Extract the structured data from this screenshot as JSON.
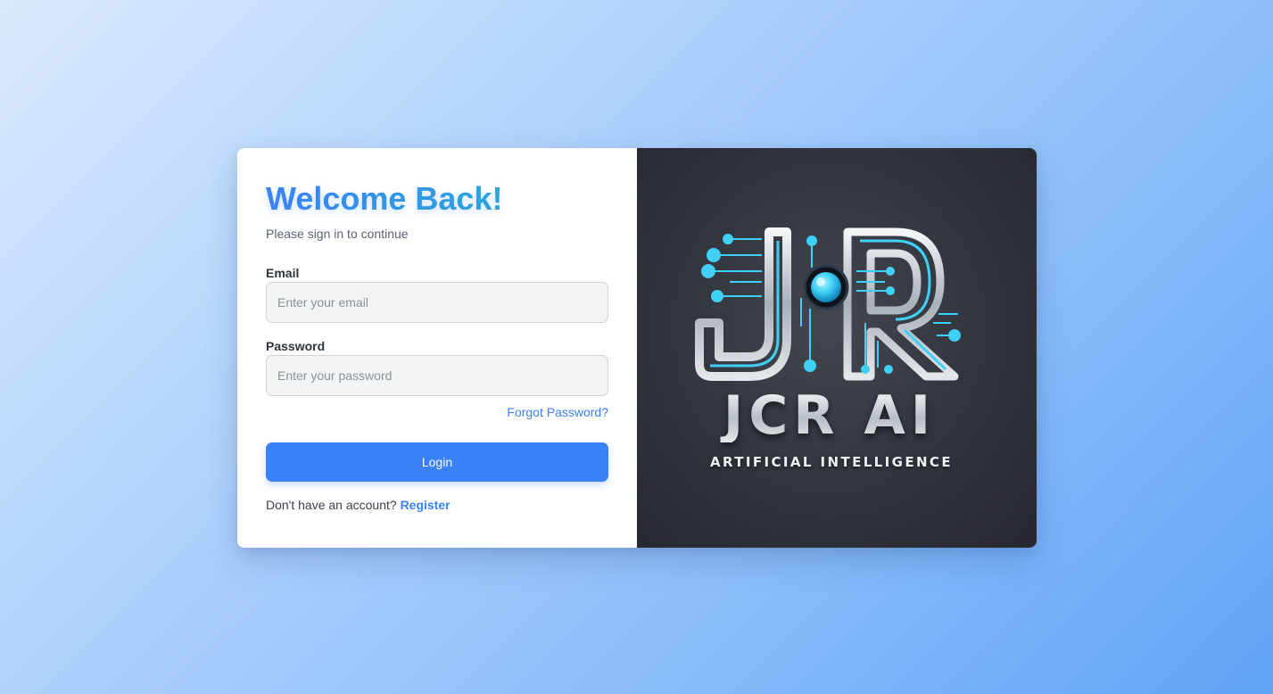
{
  "login_form": {
    "title": "Welcome Back!",
    "subtitle": "Please sign in to continue",
    "email": {
      "label": "Email",
      "placeholder": "Enter your email",
      "value": ""
    },
    "password": {
      "label": "Password",
      "placeholder": "Enter your password",
      "value": ""
    },
    "forgot_password_label": "Forgot Password?",
    "login_button_label": "Login",
    "register_prompt": "Don't have an account?",
    "register_link_label": "Register"
  },
  "brand_panel": {
    "logo_wordmark": "JCR AI",
    "logo_tagline": "ARTIFICIAL INTELLIGENCE",
    "logo_icon": "circuit-jr-monogram-icon"
  },
  "colors": {
    "accent": "#3b82f6",
    "title_gradient_end": "#2ba6dc",
    "logo_cyan": "#3fd0f5",
    "brand_panel_bg": "#2d2f37"
  }
}
